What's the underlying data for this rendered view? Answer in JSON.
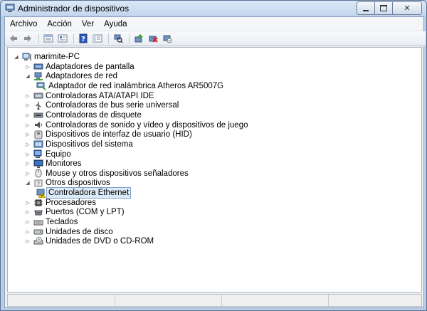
{
  "window": {
    "title": "Administrador de dispositivos"
  },
  "menu": {
    "items": [
      "Archivo",
      "Acción",
      "Ver",
      "Ayuda"
    ]
  },
  "toolbar": {
    "buttons": [
      "back-icon",
      "forward-icon",
      "up-icon",
      "properties-icon",
      "help-icon",
      "show-hide-icon",
      "scan-icon",
      "update-driver-icon",
      "uninstall-icon",
      "disable-icon"
    ]
  },
  "tree": {
    "root": "marimite-PC",
    "nodes": [
      {
        "label": "Adaptadores de pantalla",
        "icon": "display-adapter-icon",
        "state": "collapsed"
      },
      {
        "label": "Adaptadores de red",
        "icon": "network-adapter-icon",
        "state": "expanded"
      },
      {
        "label": "Adaptador de red inalámbrica Atheros AR5007G",
        "icon": "network-card-icon",
        "state": "child"
      },
      {
        "label": "Controladoras ATA/ATAPI IDE",
        "icon": "ide-icon",
        "state": "collapsed"
      },
      {
        "label": "Controladoras de bus serie universal",
        "icon": "usb-icon",
        "state": "collapsed"
      },
      {
        "label": "Controladoras de disquete",
        "icon": "floppy-controller-icon",
        "state": "collapsed"
      },
      {
        "label": "Controladoras de sonido y vídeo y dispositivos de juego",
        "icon": "sound-icon",
        "state": "collapsed"
      },
      {
        "label": "Dispositivos de interfaz de usuario (HID)",
        "icon": "hid-icon",
        "state": "collapsed"
      },
      {
        "label": "Dispositivos del sistema",
        "icon": "system-devices-icon",
        "state": "collapsed"
      },
      {
        "label": "Equipo",
        "icon": "computer-icon",
        "state": "collapsed"
      },
      {
        "label": "Monitores",
        "icon": "monitor-icon",
        "state": "collapsed"
      },
      {
        "label": "Mouse y otros dispositivos señaladores",
        "icon": "mouse-icon",
        "state": "collapsed"
      },
      {
        "label": "Otros dispositivos",
        "icon": "other-devices-icon",
        "state": "expanded"
      },
      {
        "label": "Controladora Ethernet",
        "icon": "warning-device-icon",
        "state": "child-selected"
      },
      {
        "label": "Procesadores",
        "icon": "processor-icon",
        "state": "collapsed"
      },
      {
        "label": "Puertos (COM y LPT)",
        "icon": "port-icon",
        "state": "collapsed"
      },
      {
        "label": "Teclados",
        "icon": "keyboard-icon",
        "state": "collapsed"
      },
      {
        "label": "Unidades de disco",
        "icon": "disk-drive-icon",
        "state": "collapsed"
      },
      {
        "label": "Unidades de DVD o CD-ROM",
        "icon": "dvd-drive-icon",
        "state": "collapsed"
      }
    ]
  },
  "colors": {
    "selection": "#dceaf7",
    "selection_border": "#7da2ce",
    "warning": "#f2c200"
  }
}
